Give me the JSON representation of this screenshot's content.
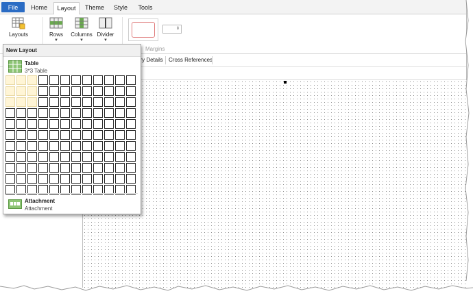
{
  "tabs": [
    {
      "label": "File"
    },
    {
      "label": "Home"
    },
    {
      "label": "Layout"
    },
    {
      "label": "Theme"
    },
    {
      "label": "Style"
    },
    {
      "label": "Tools"
    }
  ],
  "ribbon": {
    "layouts_label": "Layouts",
    "rows_label": "Rows",
    "columns_label": "Columns",
    "divider_label": "Divider",
    "margins_label": "Margins"
  },
  "panel_tabs": {
    "details_partial": "ory Details",
    "cross_references": "Cross References"
  },
  "dropdown": {
    "header": "New Layout",
    "table_title": "Table",
    "table_sub": "3*3 Table",
    "grid_cols": 12,
    "grid_rows": 11,
    "selected_cols": 3,
    "selected_rows": 3,
    "attachment_title": "Attachment",
    "attachment_sub": "Attachment"
  },
  "colors": {
    "file_tab": "#2b6cc4",
    "grid_highlight": "#fff5d6",
    "table_icon": "#6aa84f"
  }
}
